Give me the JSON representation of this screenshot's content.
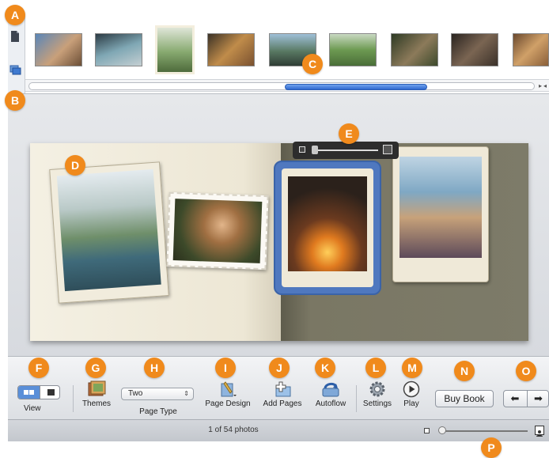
{
  "colors": {
    "callout": "#f08a1c",
    "selection": "#4f78bf",
    "scroll_thumb": "#2f68cf"
  },
  "callouts": [
    "A",
    "B",
    "C",
    "D",
    "E",
    "F",
    "G",
    "H",
    "I",
    "J",
    "K",
    "L",
    "M",
    "N",
    "O",
    "P"
  ],
  "browser": {
    "side_tabs": [
      {
        "icon": "document-icon"
      },
      {
        "icon": "photo-stack-icon"
      }
    ],
    "thumbnails": [
      {
        "name": "thumb-friends-group",
        "color": "#8c6b4a"
      },
      {
        "name": "thumb-boat-dock",
        "color": "#5c7f8f"
      },
      {
        "name": "thumb-rope-swing",
        "color": "#8ea27d"
      },
      {
        "name": "thumb-guitar-group",
        "color": "#a8783e"
      },
      {
        "name": "thumb-lake-jump",
        "color": "#6f8b7a"
      },
      {
        "name": "thumb-field-game",
        "color": "#6c9a57"
      },
      {
        "name": "thumb-picnic-table",
        "color": "#4e5a3a"
      },
      {
        "name": "thumb-wood-deck",
        "color": "#4a3f35"
      },
      {
        "name": "thumb-campfire-friends",
        "color": "#7d5b3b"
      }
    ]
  },
  "toolbar": {
    "view_label": "View",
    "themes_label": "Themes",
    "page_type_label": "Page Type",
    "page_type_value": "Two",
    "page_design_label": "Page Design",
    "add_pages_label": "Add Pages",
    "autoflow_label": "Autoflow",
    "settings_label": "Settings",
    "play_label": "Play",
    "buy_book_label": "Buy Book",
    "prev_icon": "arrow-left-icon",
    "next_icon": "arrow-right-icon"
  },
  "status": {
    "photo_count": "1 of 54 photos"
  }
}
